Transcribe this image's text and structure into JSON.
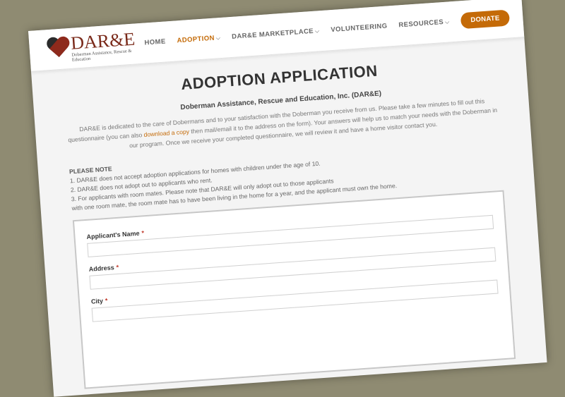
{
  "logo": {
    "title": "DAR&E",
    "subtitle": "Doberman Assistance, Rescue & Education"
  },
  "nav": [
    {
      "label": "HOME",
      "active": false,
      "dropdown": false
    },
    {
      "label": "ADOPTION",
      "active": true,
      "dropdown": true
    },
    {
      "label": "DAR&E MARKETPLACE",
      "active": false,
      "dropdown": true
    },
    {
      "label": "VOLUNTEERING",
      "active": false,
      "dropdown": false
    },
    {
      "label": "RESOURCES",
      "active": false,
      "dropdown": true
    }
  ],
  "donate_label": "DONATE",
  "page": {
    "title": "ADOPTION APPLICATION",
    "org": "Doberman Assistance, Rescue and Education, Inc. (DAR&E)",
    "intro_before": "DAR&E is dedicated to the care of Dobermans and to your satisfaction with the Doberman you receive from us. Please take a few minutes to fill out this questionnaire (you can also ",
    "intro_link": "download a copy",
    "intro_after": " then mail/email it to the address on the form). Your answers will help us to match your needs with the Doberman in our program. Once we receive your completed questionnaire, we will review it and have a home visitor contact you."
  },
  "note": {
    "heading": "PLEASE NOTE",
    "items": [
      "1. DAR&E does not accept adoption applications for homes with children under the age of 10.",
      "2. DAR&E does not adopt out to applicants who rent.",
      "3. For applicants with room mates. Please note that DAR&E will only adopt out to those applicants",
      "with one room mate, the room mate has to have been living in the home for a year, and the applicant must own the home."
    ]
  },
  "form": {
    "fields": [
      {
        "label": "Applicant's Name",
        "required": "*",
        "value": ""
      },
      {
        "label": "Address",
        "required": "*",
        "value": ""
      },
      {
        "label": "City",
        "required": "*",
        "value": ""
      }
    ]
  },
  "colors": {
    "accent": "#c46a07",
    "background": "#8f8b72",
    "required": "#c0392b"
  }
}
